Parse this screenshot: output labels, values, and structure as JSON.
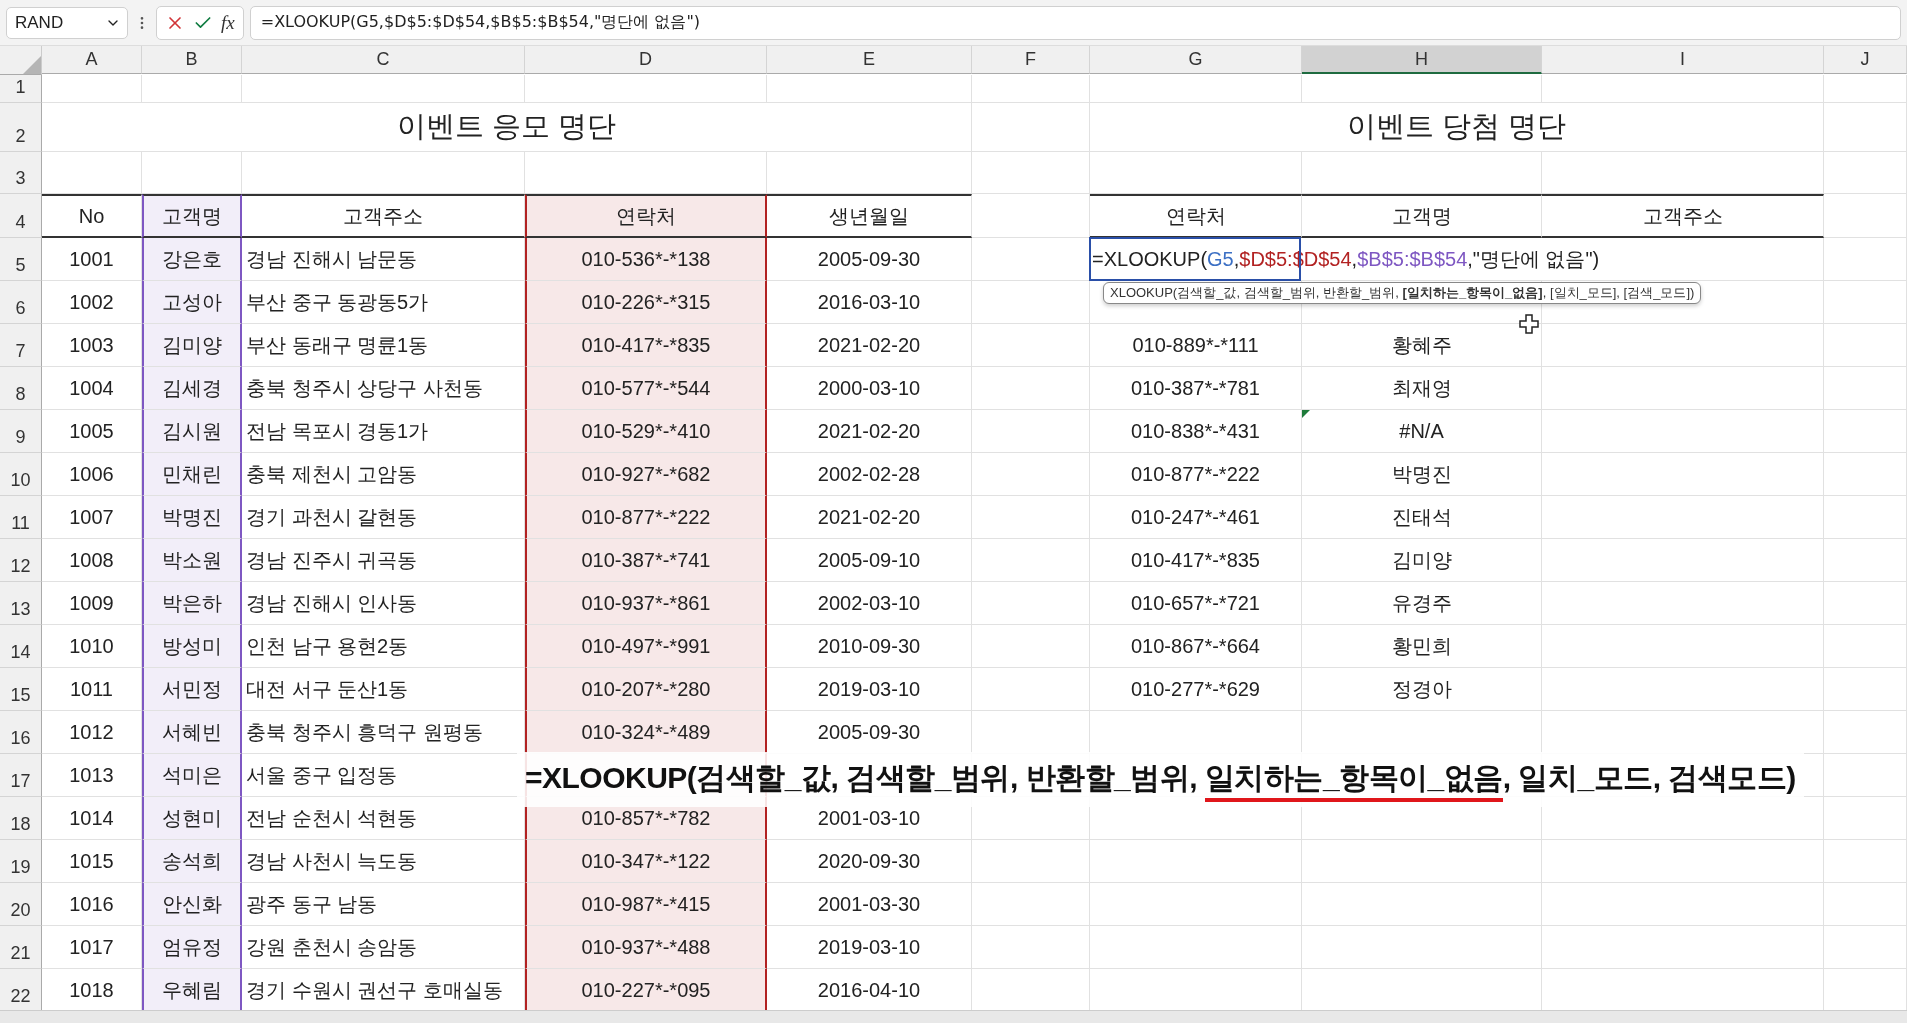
{
  "formula_bar": {
    "name_box": "RAND",
    "function_label": "fx",
    "formula": "=XLOOKUP(G5,$D$5:$D$54,$B$5:$B$54,\"명단에 없음\")"
  },
  "columns": [
    {
      "label": "A",
      "selected": false
    },
    {
      "label": "B",
      "selected": false
    },
    {
      "label": "C",
      "selected": false
    },
    {
      "label": "D",
      "selected": false
    },
    {
      "label": "E",
      "selected": false
    },
    {
      "label": "F",
      "selected": false
    },
    {
      "label": "G",
      "selected": false
    },
    {
      "label": "H",
      "selected": true
    },
    {
      "label": "I",
      "selected": false
    },
    {
      "label": "J",
      "selected": false
    }
  ],
  "row_numbers": [
    "1",
    "2",
    "3",
    "4",
    "5",
    "6",
    "7",
    "8",
    "9",
    "10",
    "11",
    "12",
    "13",
    "14",
    "15",
    "16",
    "17",
    "18",
    "19",
    "20",
    "21",
    "22"
  ],
  "entry_table": {
    "title": "이벤트 응모 명단",
    "columns": [
      {
        "label": "No"
      },
      {
        "label": "고객명",
        "color": "#7e57c2"
      },
      {
        "label": "고객주소"
      },
      {
        "label": "연락처",
        "color": "#b22222"
      },
      {
        "label": "생년월일"
      }
    ],
    "rows": [
      {
        "no": "1001",
        "name": "강은호",
        "address": "경남 진해시 남문동",
        "contact": "010-536*-*138",
        "birth": "2005-09-30"
      },
      {
        "no": "1002",
        "name": "고성아",
        "address": "부산 중구 동광동5가",
        "contact": "010-226*-*315",
        "birth": "2016-03-10"
      },
      {
        "no": "1003",
        "name": "김미양",
        "address": "부산 동래구 명륜1동",
        "contact": "010-417*-*835",
        "birth": "2021-02-20"
      },
      {
        "no": "1004",
        "name": "김세경",
        "address": "충북 청주시 상당구 사천동",
        "contact": "010-577*-*544",
        "birth": "2000-03-10"
      },
      {
        "no": "1005",
        "name": "김시원",
        "address": "전남 목포시 경동1가",
        "contact": "010-529*-*410",
        "birth": "2021-02-20"
      },
      {
        "no": "1006",
        "name": "민채린",
        "address": "충북 제천시 고암동",
        "contact": "010-927*-*682",
        "birth": "2002-02-28"
      },
      {
        "no": "1007",
        "name": "박명진",
        "address": "경기 과천시 갈현동",
        "contact": "010-877*-*222",
        "birth": "2021-02-20"
      },
      {
        "no": "1008",
        "name": "박소원",
        "address": "경남 진주시 귀곡동",
        "contact": "010-387*-*741",
        "birth": "2005-09-10"
      },
      {
        "no": "1009",
        "name": "박은하",
        "address": "경남 진해시 인사동",
        "contact": "010-937*-*861",
        "birth": "2002-03-10"
      },
      {
        "no": "1010",
        "name": "방성미",
        "address": "인천 남구 용현2동",
        "contact": "010-497*-*991",
        "birth": "2010-09-30"
      },
      {
        "no": "1011",
        "name": "서민정",
        "address": "대전 서구 둔산1동",
        "contact": "010-207*-*280",
        "birth": "2019-03-10"
      },
      {
        "no": "1012",
        "name": "서혜빈",
        "address": "충북 청주시 흥덕구 원평동",
        "contact": "010-324*-*489",
        "birth": "2005-09-30"
      },
      {
        "no": "1013",
        "name": "석미은",
        "address": "서울 중구 입정동",
        "contact": null,
        "birth": null
      },
      {
        "no": "1014",
        "name": "성현미",
        "address": "전남 순천시 석현동",
        "contact": "010-857*-*782",
        "birth": "2001-03-10"
      },
      {
        "no": "1015",
        "name": "송석희",
        "address": "경남 사천시 늑도동",
        "contact": "010-347*-*122",
        "birth": "2020-09-30"
      },
      {
        "no": "1016",
        "name": "안신화",
        "address": "광주 동구 남동",
        "contact": "010-987*-*415",
        "birth": "2001-03-30"
      },
      {
        "no": "1017",
        "name": "엄유정",
        "address": "강원 춘천시 송암동",
        "contact": "010-937*-*488",
        "birth": "2019-03-10"
      },
      {
        "no": "1018",
        "name": "우혜림",
        "address": "경기 수원시 권선구 호매실동",
        "contact": "010-227*-*095",
        "birth": "2016-04-10"
      }
    ]
  },
  "winner_table": {
    "title": "이벤트 당첨 명단",
    "columns": [
      {
        "label": "연락처"
      },
      {
        "label": "고객명"
      },
      {
        "label": "고객주소"
      }
    ],
    "editing_cell": {
      "segments": [
        {
          "text": "=XLOOKUP("
        },
        {
          "text": "G5",
          "color": "#3b6fc4"
        },
        {
          "text": ","
        },
        {
          "text": "$D$5:$D$54",
          "color": "#b22222"
        },
        {
          "text": ","
        },
        {
          "text": "$B$5:$B$54",
          "color": "#7e57c2"
        },
        {
          "text": ",\"명단에 없음\")"
        }
      ]
    },
    "rows": [
      {
        "contact": "010-889*-*111",
        "name": "황혜주",
        "flagged": false
      },
      {
        "contact": "010-387*-*781",
        "name": "최재영",
        "flagged": false
      },
      {
        "contact": "010-838*-*431",
        "name": "#N/A",
        "flagged": true
      },
      {
        "contact": "010-877*-*222",
        "name": "박명진",
        "flagged": false
      },
      {
        "contact": "010-247*-*461",
        "name": "진태석",
        "flagged": false
      },
      {
        "contact": "010-417*-*835",
        "name": "김미양",
        "flagged": false
      },
      {
        "contact": "010-657*-*721",
        "name": "유경주",
        "flagged": false
      },
      {
        "contact": "010-867*-*664",
        "name": "황민희",
        "flagged": false
      },
      {
        "contact": "010-277*-*629",
        "name": "정경아",
        "flagged": false
      }
    ]
  },
  "tooltip": {
    "text": "XLOOKUP(검색할_값, 검색할_범위, 반환할_범위, **[일치하는_항목이_없음]**, [일치_모드], [검색_모드])"
  },
  "caption": {
    "parts": [
      {
        "text": "=XLOOKUP(검색할_값, 검색할_범위, 반환할_범위, ",
        "underlined": false
      },
      {
        "text": "일치하는_항목이_없음",
        "underlined": true
      },
      {
        "text": ", 일치_모드, 검색모드)",
        "underlined": false
      }
    ]
  }
}
